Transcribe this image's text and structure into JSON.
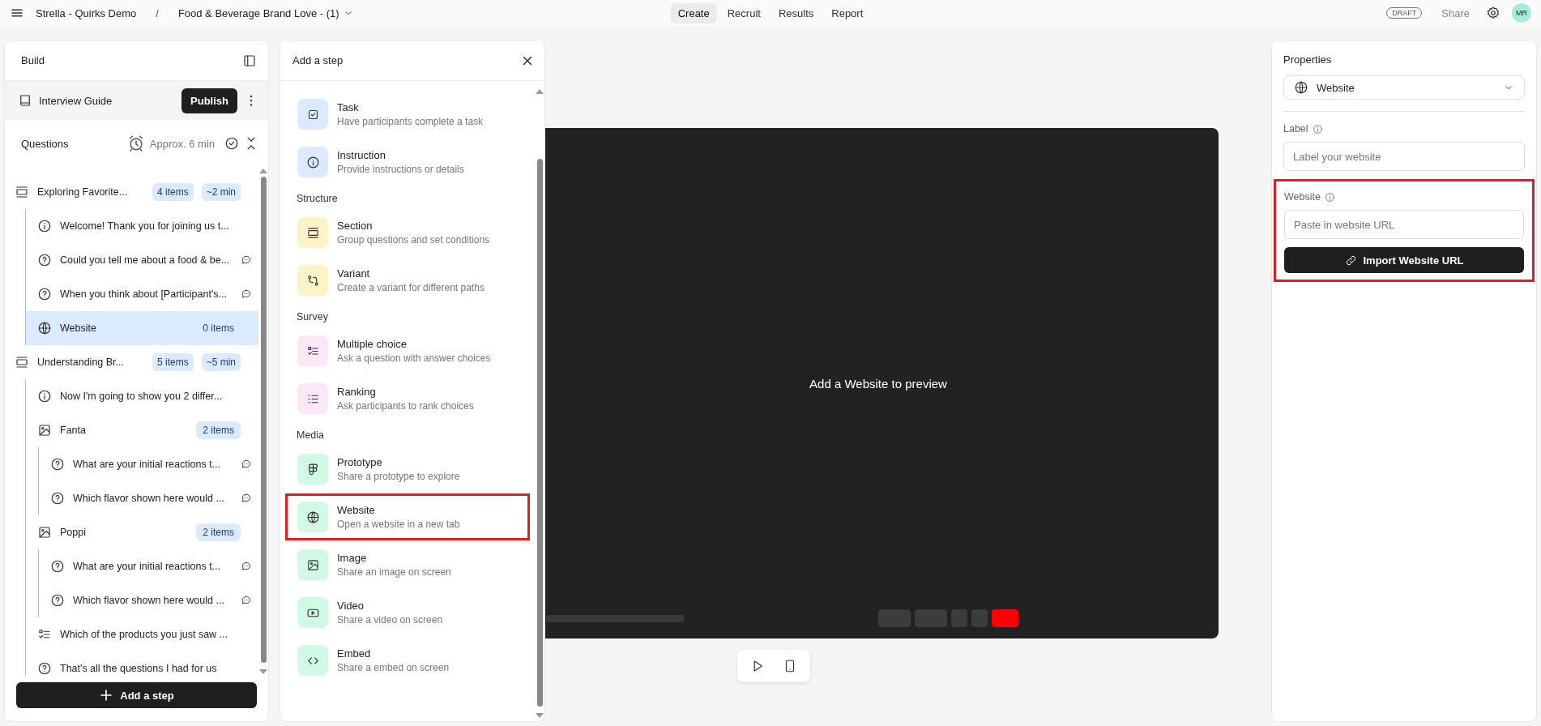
{
  "topbar": {
    "project": "Strella - Quirks Demo",
    "separator": "/",
    "study": "Food & Beverage Brand Love - (1)",
    "tabs": [
      {
        "label": "Create",
        "selected": true
      },
      {
        "label": "Recruit",
        "selected": false
      },
      {
        "label": "Results",
        "selected": false
      },
      {
        "label": "Report",
        "selected": false
      }
    ],
    "status": "DRAFT",
    "share": "Share",
    "avatar": "MR"
  },
  "build": {
    "title": "Build",
    "guide": "Interview Guide",
    "publish": "Publish",
    "questions_label": "Questions",
    "approx": "Approx. 6 min",
    "items": [
      {
        "kind": "section",
        "text": "Exploring Favorite...",
        "badges": [
          "4 items",
          "~2 min"
        ],
        "selected": false,
        "children": [
          {
            "kind": "info",
            "text": "Welcome! Thank you for joining us t...",
            "selected": false
          },
          {
            "kind": "question",
            "text": "Could you tell me about a food & be...",
            "comment": true,
            "selected": false
          },
          {
            "kind": "question",
            "text": "When you think about [Participant's...",
            "comment": true,
            "selected": false
          },
          {
            "kind": "website",
            "text": "Website",
            "badges": [
              "0 items"
            ],
            "selected": true
          }
        ]
      },
      {
        "kind": "section",
        "text": "Understanding Br...",
        "badges": [
          "5 items",
          "~5 min"
        ],
        "selected": false,
        "children": [
          {
            "kind": "info",
            "text": "Now I'm going to show you 2 differ...",
            "selected": false
          },
          {
            "kind": "image",
            "text": "Fanta",
            "badges": [
              "2 items"
            ],
            "selected": false,
            "children": [
              {
                "kind": "question",
                "text": "What are your initial reactions t...",
                "comment": true,
                "selected": false
              },
              {
                "kind": "question",
                "text": "Which flavor shown here would ...",
                "comment": true,
                "selected": false
              }
            ]
          },
          {
            "kind": "image",
            "text": "Poppi",
            "badges": [
              "2 items"
            ],
            "selected": false,
            "children": [
              {
                "kind": "question",
                "text": "What are your initial reactions t...",
                "comment": true,
                "selected": false
              },
              {
                "kind": "question",
                "text": "Which flavor shown here would ...",
                "comment": true,
                "selected": false
              }
            ]
          },
          {
            "kind": "choice",
            "text": "Which of the products you just saw ...",
            "selected": false
          },
          {
            "kind": "question",
            "text": "That's all the questions I had for us",
            "selected": false
          }
        ]
      }
    ],
    "add_step": "Add a step"
  },
  "step_menu": {
    "title": "Add a step",
    "groups": [
      {
        "items": [
          {
            "kind": "task",
            "title": "Task",
            "description": "Have participants complete a task",
            "color": "#dbeafe",
            "highlighted": false
          },
          {
            "kind": "info",
            "title": "Instruction",
            "description": "Provide instructions or details",
            "color": "#dbeafe",
            "highlighted": false
          }
        ]
      },
      {
        "heading": "Structure",
        "items": [
          {
            "kind": "section",
            "title": "Section",
            "description": "Group questions and set conditions",
            "color": "#fef3c7",
            "highlighted": false
          },
          {
            "kind": "variant",
            "title": "Variant",
            "description": "Create a variant for different paths",
            "color": "#fef3c7",
            "highlighted": false
          }
        ]
      },
      {
        "heading": "Survey",
        "items": [
          {
            "kind": "choice",
            "title": "Multiple choice",
            "description": "Ask a question with answer choices",
            "color": "#fce7f6",
            "highlighted": false
          },
          {
            "kind": "ranking",
            "title": "Ranking",
            "description": "Ask participants to rank choices",
            "color": "#fce7f6",
            "highlighted": false
          }
        ]
      },
      {
        "heading": "Media",
        "items": [
          {
            "kind": "prototype",
            "title": "Prototype",
            "description": "Share a prototype to explore",
            "color": "#d1fae5",
            "highlighted": false
          },
          {
            "kind": "website",
            "title": "Website",
            "description": "Open a website in a new tab",
            "color": "#d1fae5",
            "highlighted": true
          },
          {
            "kind": "image",
            "title": "Image",
            "description": "Share an image on screen",
            "color": "#d1fae5",
            "highlighted": false
          },
          {
            "kind": "video",
            "title": "Video",
            "description": "Share a video on screen",
            "color": "#d1fae5",
            "highlighted": false
          },
          {
            "kind": "embed",
            "title": "Embed",
            "description": "Share a embed on screen",
            "color": "#d1fae5",
            "highlighted": false
          }
        ]
      }
    ]
  },
  "preview": {
    "message": "Add a Website to preview"
  },
  "properties": {
    "title": "Properties",
    "type": "Website",
    "label_field": {
      "label": "Label",
      "placeholder": "Label your website"
    },
    "website_field": {
      "label": "Website",
      "placeholder": "Paste in website URL",
      "button": "Import Website URL",
      "highlighted": true
    }
  }
}
